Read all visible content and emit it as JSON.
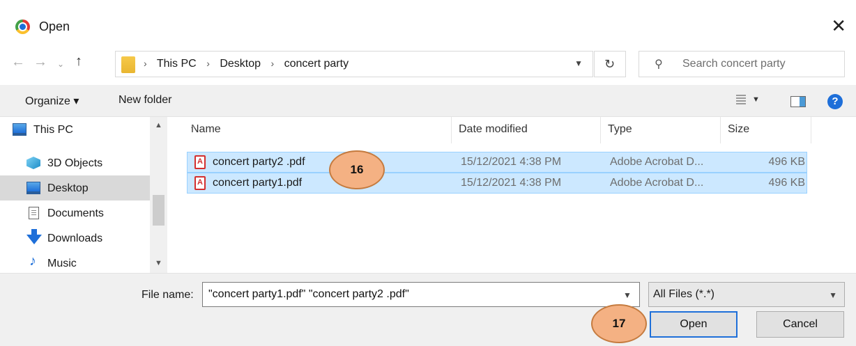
{
  "window": {
    "title": "Open",
    "close_glyph": "✕"
  },
  "nav": {
    "back": "←",
    "forward": "→",
    "recent": "⌄",
    "up": "↑"
  },
  "address": {
    "crumbs": [
      "This PC",
      "Desktop",
      "concert party"
    ],
    "separator": "›"
  },
  "search": {
    "placeholder": "Search concert party"
  },
  "toolbar": {
    "organize": "Organize ▾",
    "new_folder": "New folder",
    "help": "?"
  },
  "sidebar": {
    "items": [
      {
        "label": "This PC",
        "icon": "monitor-icon"
      },
      {
        "label": "3D Objects",
        "icon": "cube-icon"
      },
      {
        "label": "Desktop",
        "icon": "monitor-icon",
        "selected": true
      },
      {
        "label": "Documents",
        "icon": "document-icon"
      },
      {
        "label": "Downloads",
        "icon": "download-arrow-icon"
      },
      {
        "label": "Music",
        "icon": "music-note-icon"
      }
    ]
  },
  "columns": [
    "Name",
    "Date modified",
    "Type",
    "Size"
  ],
  "files": [
    {
      "name": "concert party2 .pdf",
      "date": "15/12/2021 4:38 PM",
      "type": "Adobe Acrobat D...",
      "size": "496 KB"
    },
    {
      "name": "concert party1.pdf",
      "date": "15/12/2021 4:38 PM",
      "type": "Adobe Acrobat D...",
      "size": "496 KB"
    }
  ],
  "footer": {
    "file_name_label": "File name:",
    "file_name_value": "\"concert party1.pdf\" \"concert party2 .pdf\"",
    "filter": "All Files (*.*)",
    "open": "Open",
    "cancel": "Cancel"
  },
  "badges": {
    "step1": "16",
    "step2": "17"
  },
  "colors": {
    "accent": "#1e6fd9",
    "selection": "#cce8ff",
    "badge": "#f4b183"
  }
}
